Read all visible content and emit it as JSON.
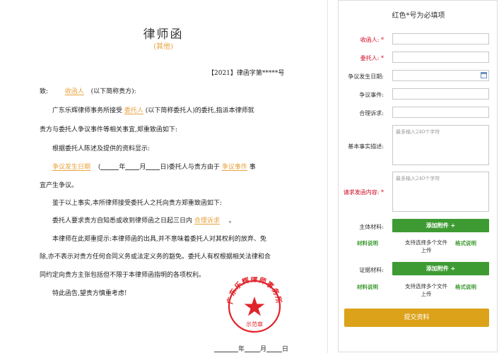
{
  "letter": {
    "title": "律师函",
    "subtitle": "(其他)",
    "letter_no": "【2021】律函字第*****号",
    "to_prefix": "致:",
    "recipient": "收函人",
    "to_suffix": "(以下简称贵方):",
    "p1_a": "广东乐辉律师事务所接受",
    "p1_client": "委托人",
    "p1_b": "(以下简称委托人)的委托,指派本律师就",
    "p1_c": "贵方与委托人争议事件等相关事宜,郑重致函如下:",
    "p2": "根据委托人陈述及提供的资料显示:",
    "p3_date": "争议发生日期",
    "p3_paren_open": "(",
    "p3_year": "年",
    "p3_month": "月",
    "p3_day": "日)委托人与贵方由于",
    "p3_event": "争议事件",
    "p3_end": "事",
    "p3_c": "宜产生争议。",
    "p4": "鉴于以上事实,本所律师接受委托人之托向贵方郑重致函如下:",
    "p5_a": "委托人要求贵方自知悉或收到律师函之日起三日内",
    "p5_claim": "合理诉求",
    "p5_end": "。",
    "p6_a": "本律师在此郑重提示:本律师函的出具,并不意味着委托人对其权利的放弃、免",
    "p6_b": "除,亦不表示对贵方任何合同义务或法定义务的豁免。委托人有权根据相关法律和合",
    "p6_c": "同约定向贵方主张包括但不限于本律师函指明的各项权利。",
    "p7": "特此函告,望贵方慎重考虑!",
    "seal_text": "广东乐辉律师事务所",
    "seal_sub": "示范章",
    "date_year": "年",
    "date_month": "月",
    "date_day": "日"
  },
  "form": {
    "title": "红色*号为必填项",
    "recipient_label": "收函人:",
    "client_label": "委托人:",
    "date_label": "争议发生日期:",
    "event_label": "争议事件:",
    "claim_label": "合理诉求:",
    "facts_label": "基本事实描述:",
    "facts_placeholder": "最多输入240个字符",
    "demand_label": "请求发函内容:",
    "demand_placeholder": "最多输入240个字符",
    "star": "*",
    "main_material_label": "主体材料:",
    "evidence_material_label": "证据材料:",
    "add_attachment": "添加附件 +",
    "material_note": "材料说明",
    "multi_upload_hint": "支持选择多个文件上传",
    "format_note": "格式说明",
    "submit": "提交资料"
  },
  "colors": {
    "highlight": "#e6a23c",
    "required": "#d0021b",
    "green": "#3e9b33",
    "submit": "#dca21a",
    "seal": "#e0242b"
  }
}
